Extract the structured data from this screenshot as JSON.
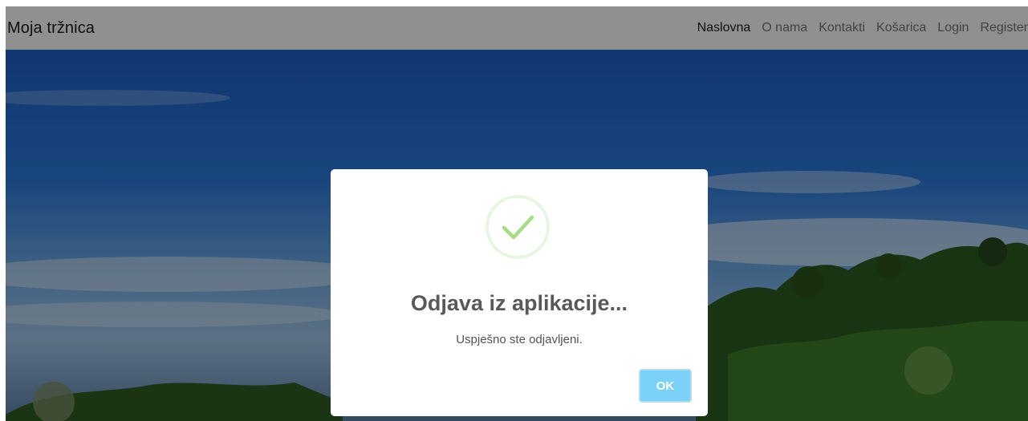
{
  "navbar": {
    "brand": "Moja tržnica",
    "links": [
      "Naslovna",
      "O nama",
      "Kontakti",
      "Košarica",
      "Login",
      "Register"
    ],
    "active": "Naslovna"
  },
  "modal": {
    "icon": "success-check-icon",
    "title": "Odjava iz aplikacije...",
    "text": "Uspješno ste odjavljeni.",
    "confirm_label": "OK"
  },
  "colors": {
    "success": "#a5dc86",
    "confirm_button": "#7cd1f9"
  }
}
